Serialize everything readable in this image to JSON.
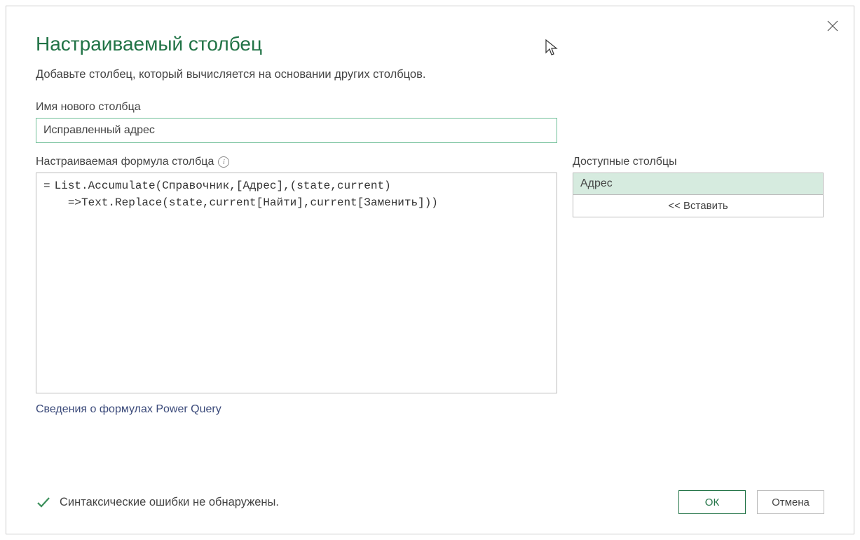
{
  "dialog": {
    "title": "Настраиваемый столбец",
    "subtitle": "Добавьте столбец, который вычисляется на основании других столбцов.",
    "column_name_label": "Имя нового столбца",
    "column_name_value": "Исправленный адрес",
    "formula_label": "Настраиваемая формула столбца",
    "formula_value": "List.Accumulate(Справочник,[Адрес],(state,current)\n  =>Text.Replace(state,current[Найти],current[Заменить]))",
    "help_link": "Сведения о формулах Power Query",
    "available_columns_label": "Доступные столбцы",
    "available_columns": [
      {
        "name": "Адрес",
        "selected": true
      }
    ],
    "insert_button": "<< Вставить",
    "status_text": "Синтаксические ошибки не обнаружены.",
    "ok_button": "ОК",
    "cancel_button": "Отмена"
  },
  "icons": {
    "close": "close-icon",
    "info": "info-icon",
    "check": "check-icon",
    "cursor": "cursor-icon"
  }
}
